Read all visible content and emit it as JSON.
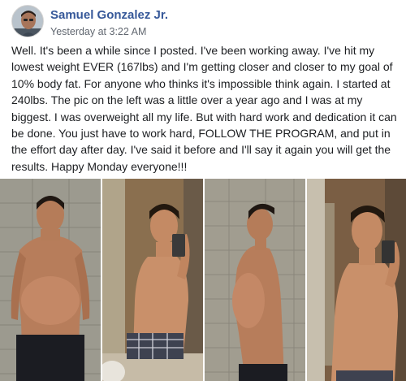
{
  "post": {
    "author": "Samuel Gonzalez Jr.",
    "timestamp": "Yesterday at 3:22 AM",
    "message": "Well. It's been a while since I posted. I've been working away. I've hit my lowest weight EVER (167lbs) and I'm getting closer and closer to my goal of 10% body fat. For anyone who thinks it's impossible think again. I started at 240lbs. The pic on the left was a little over a year ago and I was at my biggest. I was overweight all my life. But with hard work and dedication it can be done. You just have to work hard, FOLLOW THE PROGRAM, and put in the effort day after day. I've said it before and I'll say it again you will get the results. Happy Monday everyone!!!"
  },
  "photos": {
    "count": 4,
    "items": [
      {
        "subject": "front-view-before"
      },
      {
        "subject": "mirror-selfie-after"
      },
      {
        "subject": "side-view-before"
      },
      {
        "subject": "mirror-selfie-after-closeup"
      }
    ]
  },
  "colors": {
    "author_link": "#365899",
    "meta_text": "#616770",
    "body_text": "#1c1e21",
    "background": "#ffffff"
  },
  "icons": [
    "profile-avatar"
  ]
}
